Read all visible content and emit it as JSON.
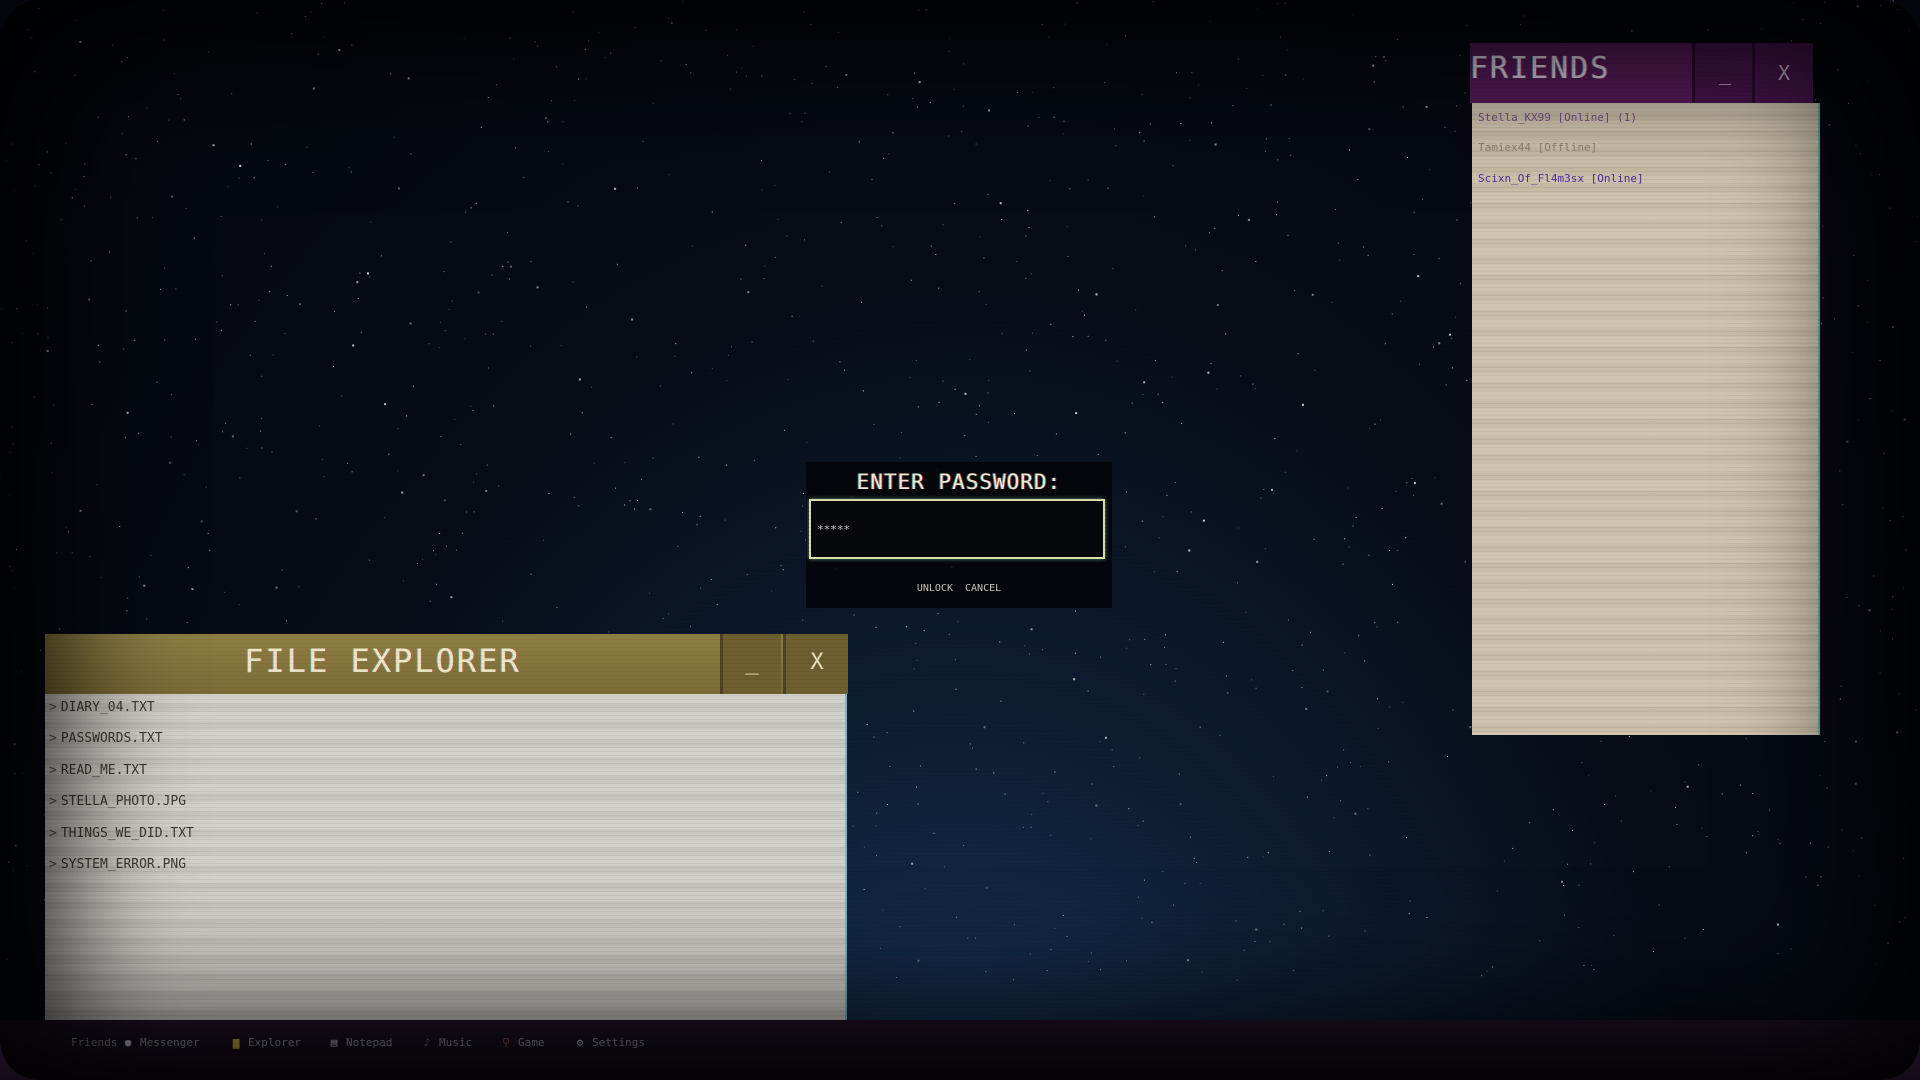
{
  "password_prompt": {
    "label": "ENTER PASSWORD:",
    "input_value": "*****",
    "unlock_label": "UNLOCK",
    "cancel_label": "CANCEL"
  },
  "file_explorer": {
    "title": "FILE EXPLORER",
    "minimize_label": "_",
    "close_label": "X",
    "files": [
      {
        "name": "DIARY_04.TXT"
      },
      {
        "name": "PASSWORDS.TXT"
      },
      {
        "name": "READ_ME.TXT"
      },
      {
        "name": "STELLA_PHOTO.JPG"
      },
      {
        "name": "THINGS_WE_DID.TXT"
      },
      {
        "name": "SYSTEM_ERROR.PNG"
      }
    ],
    "file_arrow": ">"
  },
  "friends": {
    "title": "FRIENDS",
    "minimize_label": "_",
    "close_label": "X",
    "items": [
      {
        "label": "Stella_KX99 [Online] (1)",
        "color": "#7a4a86"
      },
      {
        "label": "Tamiex44 [Offline]",
        "color": "#8d8576"
      },
      {
        "label": "Scixn_Of_Fl4m3sx [Online]",
        "color": "#4b2f9a"
      }
    ]
  },
  "taskbar": {
    "items": [
      {
        "label": "Friends",
        "icon": "friends-icon",
        "glyph": ""
      },
      {
        "label": "Messenger",
        "icon": "chat-bubble-icon",
        "glyph": "●"
      },
      {
        "label": "Explorer",
        "icon": "folder-icon",
        "glyph": "▆"
      },
      {
        "label": "Notepad",
        "icon": "notepad-icon",
        "glyph": "▤"
      },
      {
        "label": "Music",
        "icon": "music-icon",
        "glyph": "♪"
      },
      {
        "label": "Game",
        "icon": "joystick-icon",
        "glyph": "⚲"
      },
      {
        "label": "Settings",
        "icon": "gear-icon",
        "glyph": "⚙"
      }
    ]
  },
  "colors": {
    "explorer_titlebar": "#8f7f45",
    "friends_titlebar": "#5a1c5c",
    "taskbar": "#221428",
    "password_border": "#d9e0a8"
  }
}
